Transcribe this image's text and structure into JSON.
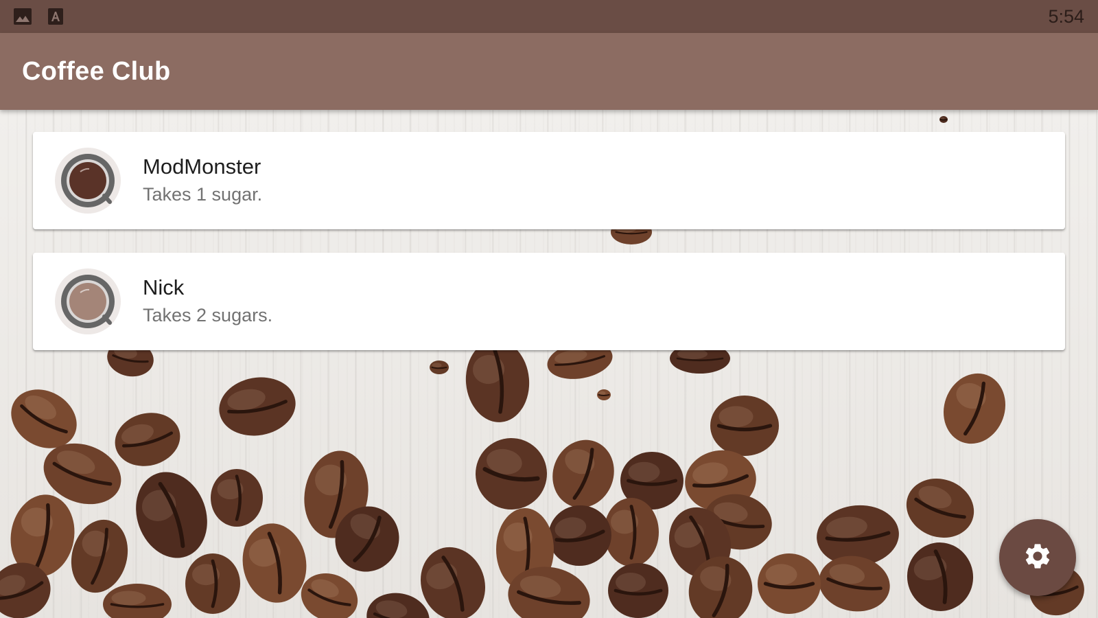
{
  "status_bar": {
    "time": "5:54",
    "icons": [
      "image-icon",
      "font-a-icon"
    ]
  },
  "app_bar": {
    "title": "Coffee Club"
  },
  "drinkers": [
    {
      "name": "ModMonster",
      "detail": "Takes 1 sugar.",
      "icon": "coffee-cup-icon",
      "coffee_color": "#5a3328"
    },
    {
      "name": "Nick",
      "detail": "Takes 2 sugars.",
      "icon": "coffee-cup-icon",
      "coffee_color": "#a48578"
    }
  ],
  "fab": {
    "icon": "gear-icon"
  },
  "colors": {
    "status_bar": "#6a4d45",
    "app_bar": "#8c6c62",
    "fab": "#6b4a42",
    "card": "#ffffff"
  }
}
